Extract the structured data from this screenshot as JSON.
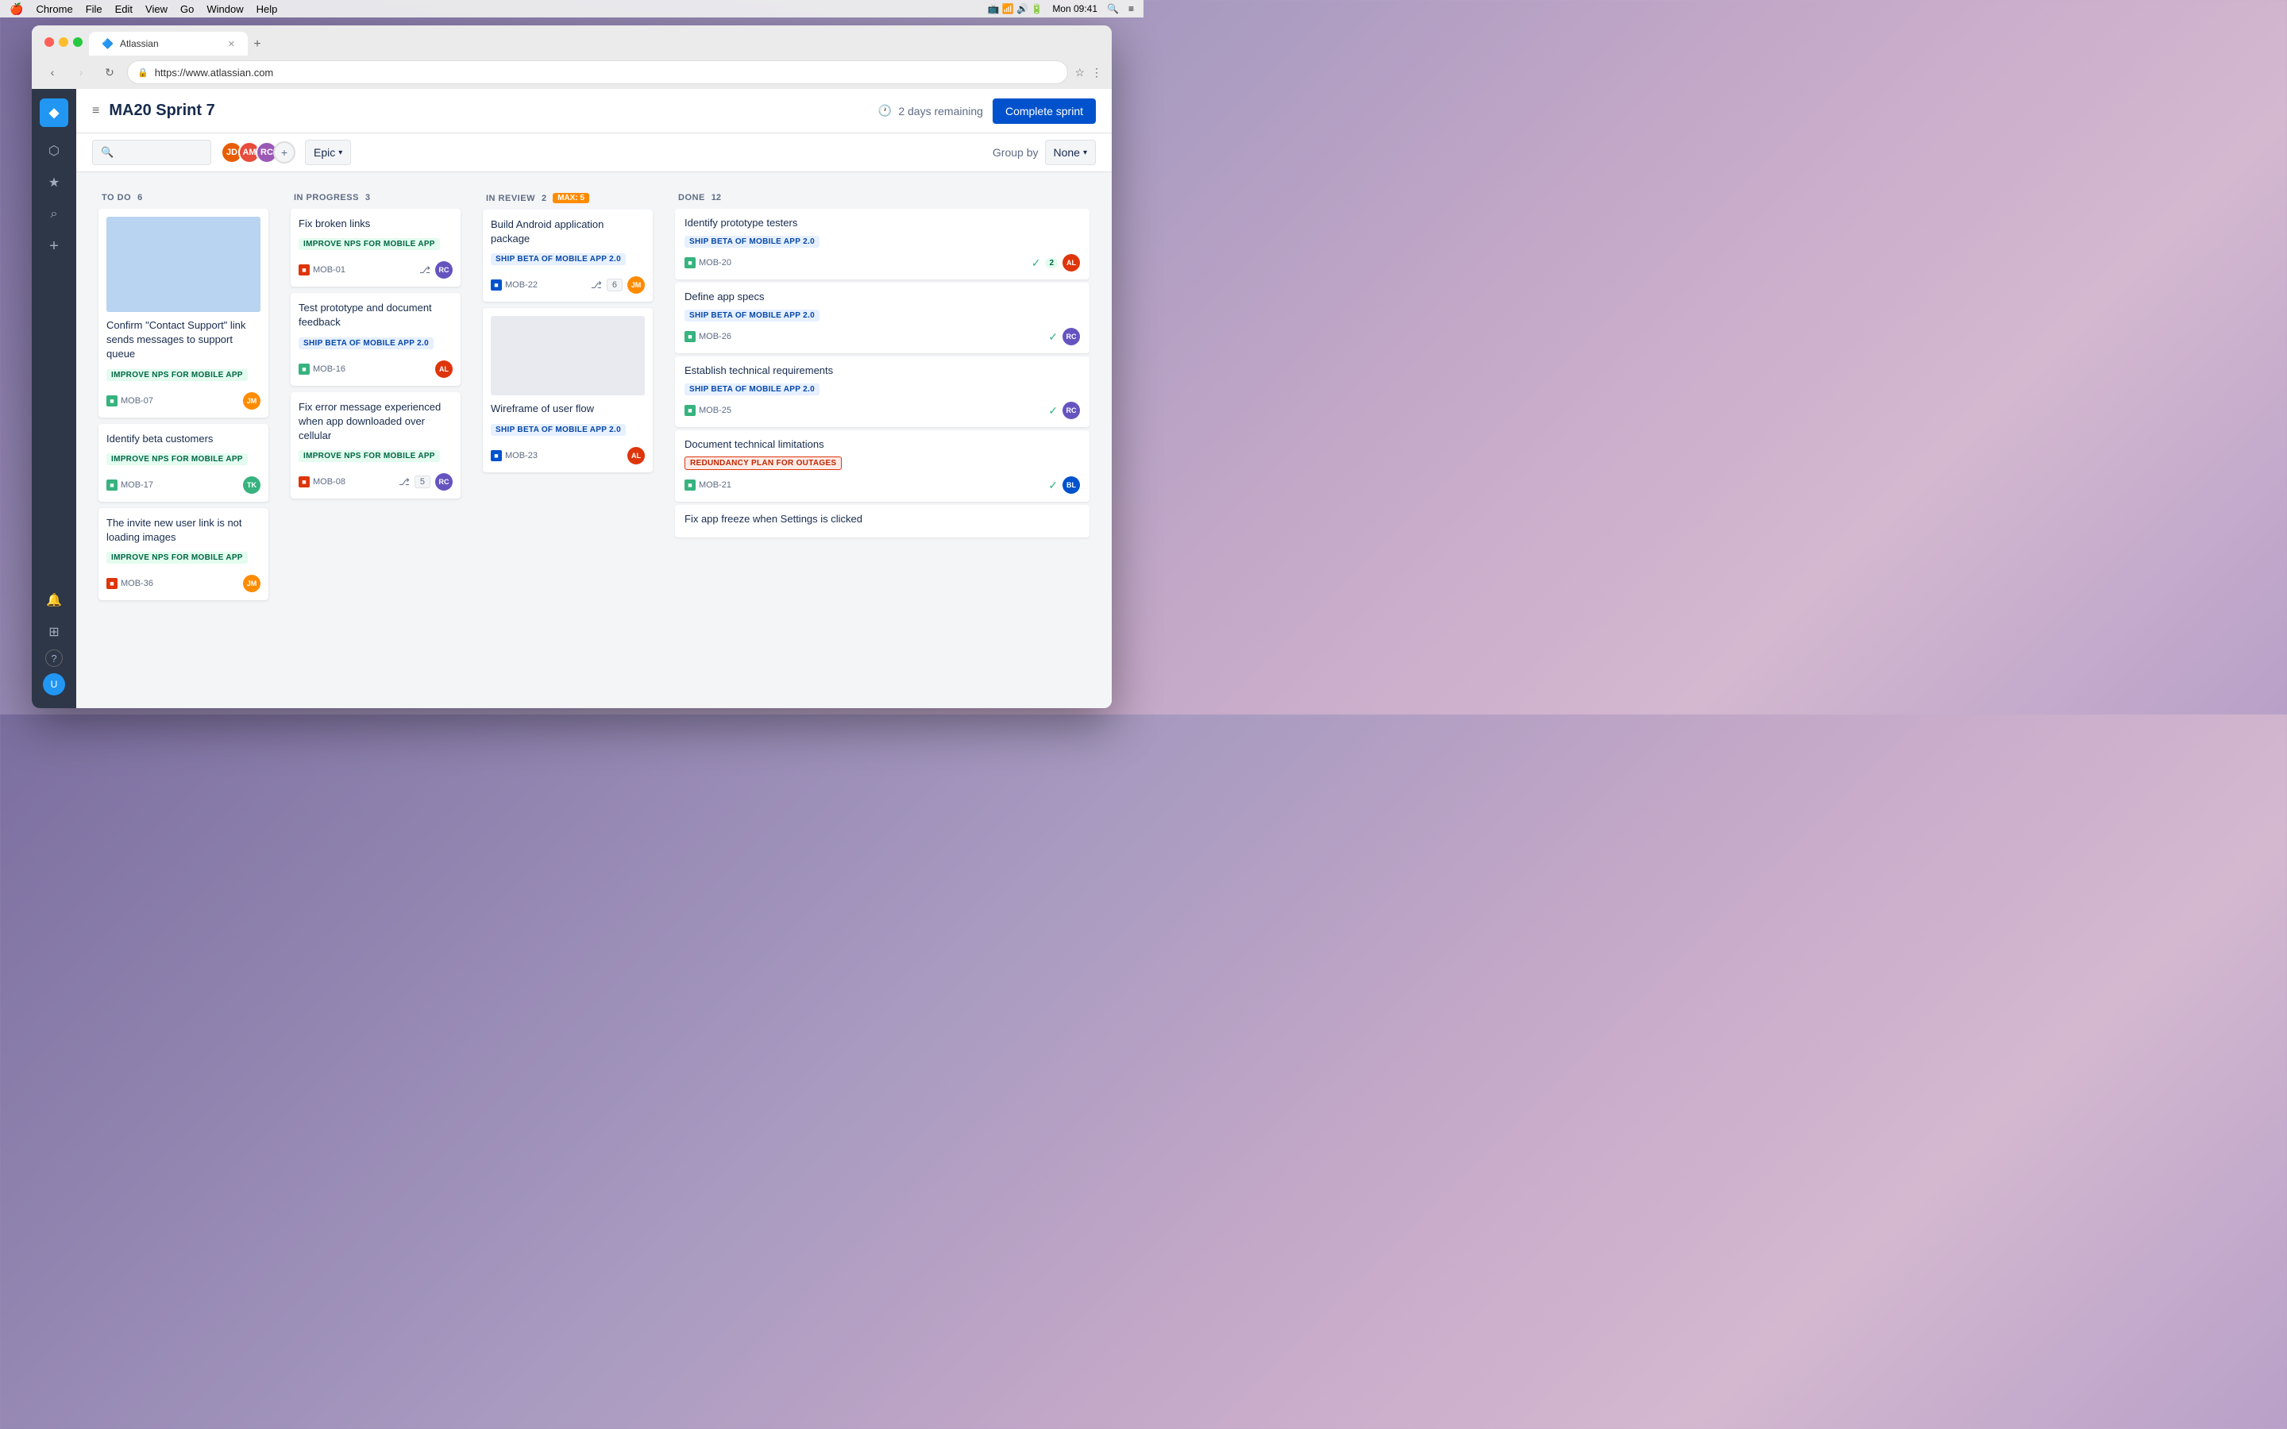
{
  "menubar": {
    "apple": "🍎",
    "appName": "Chrome",
    "menus": [
      "File",
      "Edit",
      "View",
      "Go",
      "Window",
      "Help"
    ],
    "time": "Mon 09:41"
  },
  "browser": {
    "tab": {
      "label": "Atlassian",
      "favicon": "🔷"
    },
    "url": "https://www.atlassian.com",
    "newTabLabel": "+"
  },
  "sidebar": {
    "logo": "◆",
    "items": [
      {
        "id": "boards",
        "icon": "⬡",
        "label": "Boards"
      },
      {
        "id": "starred",
        "icon": "★",
        "label": "Starred"
      },
      {
        "id": "search",
        "icon": "🔍",
        "label": "Search"
      },
      {
        "id": "create",
        "icon": "+",
        "label": "Create"
      }
    ],
    "bottom_items": [
      {
        "id": "notifications",
        "icon": "🔔",
        "label": "Notifications"
      },
      {
        "id": "apps",
        "icon": "⊞",
        "label": "Apps"
      },
      {
        "id": "help",
        "icon": "?",
        "label": "Help"
      },
      {
        "id": "profile",
        "icon": "👤",
        "label": "Profile"
      }
    ]
  },
  "header": {
    "menu_icon": "≡",
    "sprint_title": "MA20 Sprint 7",
    "time_remaining": "2 days remaining",
    "complete_sprint_btn": "Complete sprint"
  },
  "toolbar": {
    "search_placeholder": "Search",
    "epic_filter": "Epic",
    "group_by_label": "Group by",
    "group_by_value": "None",
    "add_member_icon": "+"
  },
  "columns": [
    {
      "id": "todo",
      "title": "TO DO",
      "count": 6,
      "max": null,
      "cards": [
        {
          "id": "todo-1",
          "has_image": true,
          "title": "Confirm \"Contact Support\" link sends messages to support queue",
          "label": "IMPROVE NPS FOR MOBILE APP",
          "label_type": "improve",
          "card_id": "MOB-07",
          "icon_type": "story",
          "avatar_color": "#ff8b00",
          "avatar_text": "JM",
          "story_points": null,
          "branch": false,
          "check": false,
          "check_count": null
        },
        {
          "id": "todo-2",
          "has_image": false,
          "title": "Identify beta customers",
          "label": "IMPROVE NPS FOR MOBILE APP",
          "label_type": "improve",
          "card_id": "MOB-17",
          "icon_type": "story",
          "avatar_color": "#36b37e",
          "avatar_text": "TK",
          "story_points": null,
          "branch": false,
          "check": false,
          "check_count": null
        },
        {
          "id": "todo-3",
          "has_image": false,
          "title": "The invite new user link is not loading images",
          "label": "IMPROVE NPS FOR MOBILE APP",
          "label_type": "improve",
          "card_id": "MOB-36",
          "icon_type": "bug",
          "avatar_color": "#ff8b00",
          "avatar_text": "JM",
          "story_points": null,
          "branch": false,
          "check": false,
          "check_count": null
        }
      ]
    },
    {
      "id": "inprogress",
      "title": "IN PROGRESS",
      "count": 3,
      "max": null,
      "cards": [
        {
          "id": "ip-1",
          "has_image": false,
          "title": "Fix broken links",
          "label": "IMPROVE NPS FOR MOBILE APP",
          "label_type": "improve",
          "card_id": "MOB-01",
          "icon_type": "bug",
          "avatar_color": "#6554c0",
          "avatar_text": "RC",
          "story_points": null,
          "branch": true,
          "check": false,
          "check_count": null
        },
        {
          "id": "ip-2",
          "has_image": false,
          "title": "Test prototype and document feedback",
          "label": "SHIP BETA OF MOBILE APP 2.0",
          "label_type": "ship",
          "card_id": "MOB-16",
          "icon_type": "story",
          "avatar_color": "#de350b",
          "avatar_text": "AL",
          "story_points": null,
          "branch": false,
          "check": false,
          "check_count": null
        },
        {
          "id": "ip-3",
          "has_image": false,
          "title": "Fix error message experienced when app downloaded over cellular",
          "label": "IMPROVE NPS FOR MOBILE APP",
          "label_type": "improve",
          "card_id": "MOB-08",
          "icon_type": "bug",
          "avatar_color": "#6554c0",
          "avatar_text": "RC",
          "story_points": 5,
          "branch": true,
          "check": false,
          "check_count": null
        }
      ]
    },
    {
      "id": "inreview",
      "title": "IN REVIEW",
      "count": 2,
      "max": 5,
      "cards": [
        {
          "id": "ir-1",
          "has_image": false,
          "title": "Build Android application package",
          "label": "SHIP BETA OF MOBILE APP 2.0",
          "label_type": "ship",
          "card_id": "MOB-22",
          "icon_type": "task",
          "avatar_color": "#ff8b00",
          "avatar_text": "JM",
          "story_points": 6,
          "branch": true,
          "check": false,
          "check_count": null
        },
        {
          "id": "ir-2",
          "has_image": false,
          "title": "Wireframe of user flow",
          "label": "SHIP BETA OF MOBILE APP 2.0",
          "label_type": "ship",
          "card_id": "MOB-23",
          "icon_type": "task",
          "avatar_color": "#de350b",
          "avatar_text": "AL",
          "story_points": null,
          "branch": false,
          "check": false,
          "check_count": null
        }
      ]
    },
    {
      "id": "done",
      "title": "DONE",
      "count": 12,
      "max": null,
      "cards": [
        {
          "id": "d-1",
          "title": "Identify prototype testers",
          "label": "SHIP BETA OF MOBILE APP 2.0",
          "label_type": "ship",
          "card_id": "MOB-20",
          "icon_type": "story",
          "avatar_color": "#de350b",
          "avatar_text": "AL",
          "check": true,
          "check_count": 2
        },
        {
          "id": "d-2",
          "title": "Define app specs",
          "label": "SHIP BETA OF MOBILE APP 2.0",
          "label_type": "ship",
          "card_id": "MOB-26",
          "icon_type": "story",
          "avatar_color": "#6554c0",
          "avatar_text": "RC",
          "check": true,
          "check_count": null
        },
        {
          "id": "d-3",
          "title": "Establish technical requirements",
          "label": "SHIP BETA OF MOBILE APP 2.0",
          "label_type": "ship",
          "card_id": "MOB-25",
          "icon_type": "story",
          "avatar_color": "#6554c0",
          "avatar_text": "RC",
          "check": true,
          "check_count": null
        },
        {
          "id": "d-4",
          "title": "Document technical limitations",
          "label": "REDUNDANCY PLAN FOR OUTAGES",
          "label_type": "redundancy",
          "card_id": "MOB-21",
          "icon_type": "story",
          "avatar_color": "#0052cc",
          "avatar_text": "BL",
          "check": true,
          "check_count": null
        },
        {
          "id": "d-5",
          "title": "Fix app freeze when Settings is clicked",
          "label": "",
          "label_type": "",
          "card_id": "",
          "icon_type": "",
          "avatar_color": "",
          "avatar_text": "",
          "check": false,
          "check_count": null
        }
      ]
    }
  ],
  "avatars": [
    {
      "color": "#e85d04",
      "initials": "JD"
    },
    {
      "color": "#e74c3c",
      "initials": "AM"
    },
    {
      "color": "#9b59b6",
      "initials": "RC"
    }
  ]
}
